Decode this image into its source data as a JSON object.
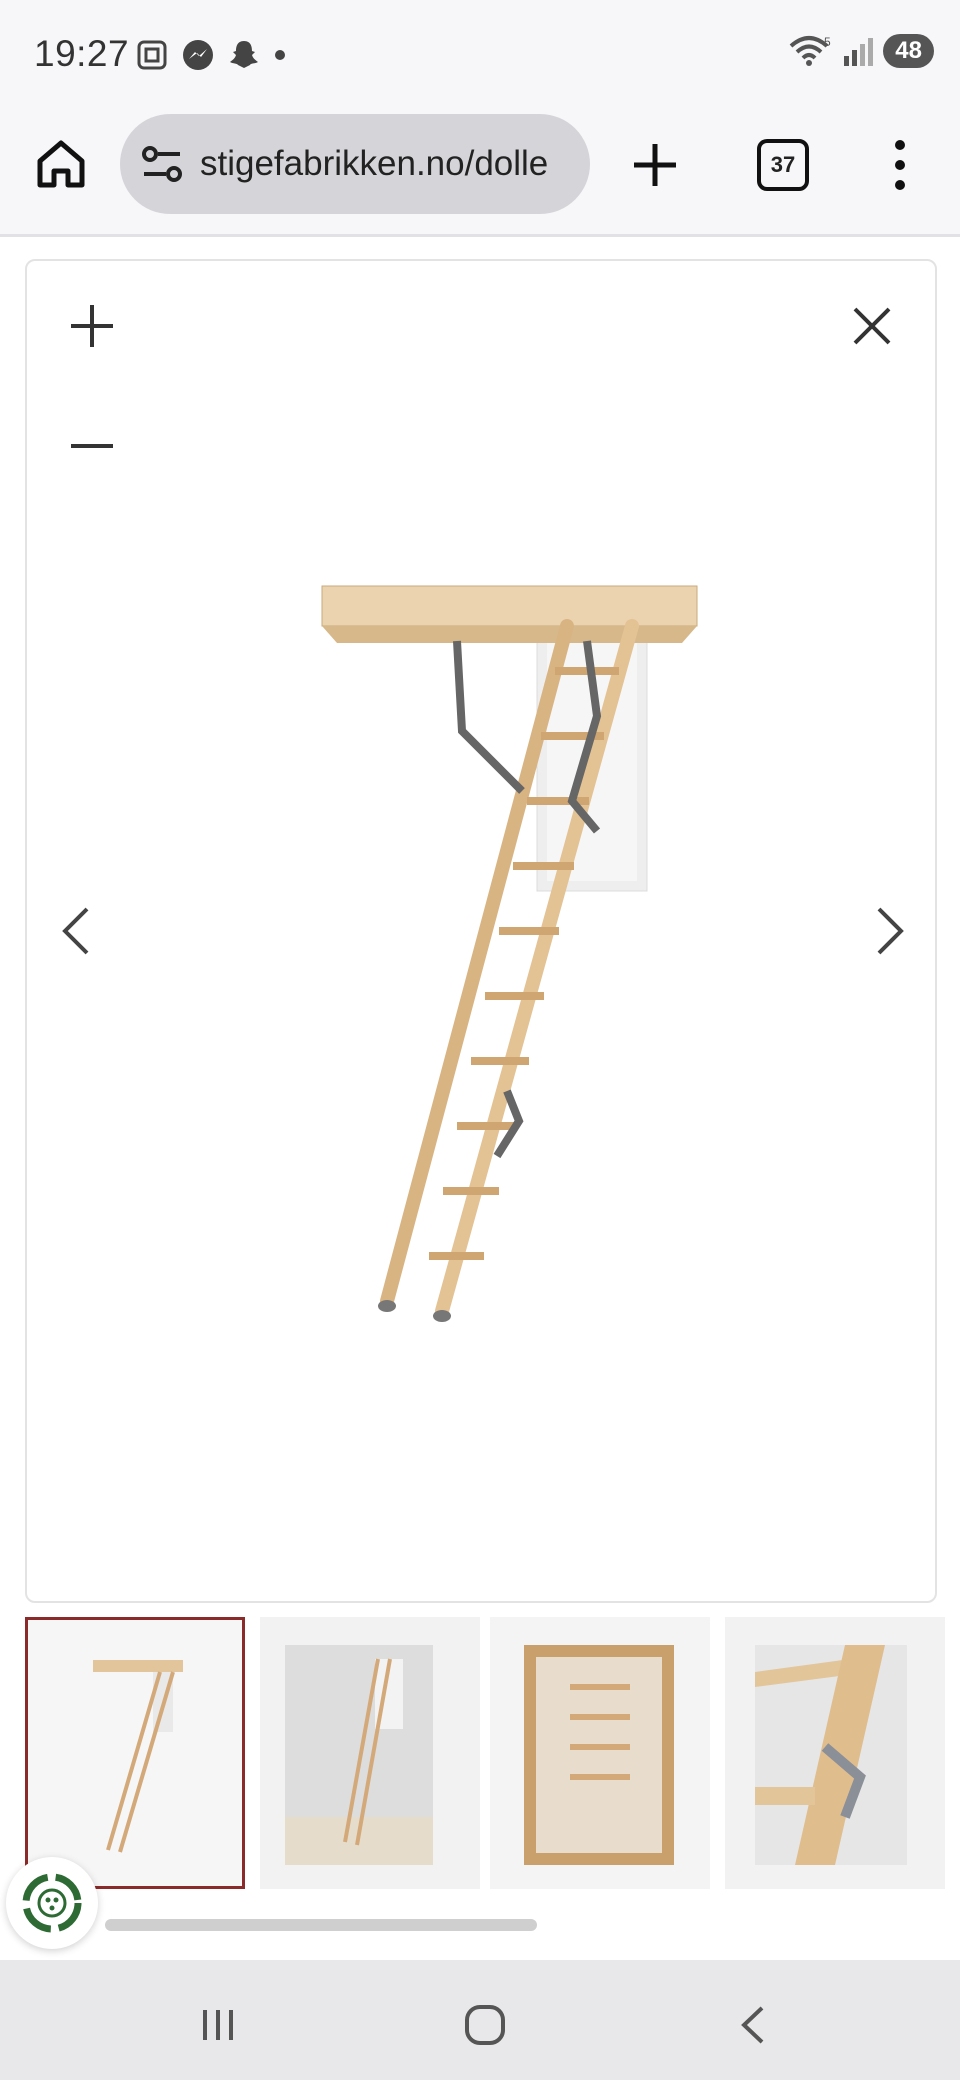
{
  "status_bar": {
    "time": "19:27",
    "left_icons": [
      "screenshot-icon",
      "messenger-icon",
      "snapchat-icon",
      "dot-icon"
    ],
    "right_icons": [
      "wifi-icon",
      "signal-icon"
    ],
    "wifi_badge": "5",
    "battery": "48"
  },
  "toolbar": {
    "url": "stigefabrikken.no/dolle",
    "tab_count": "37",
    "icons": [
      "home-icon",
      "site-settings-icon",
      "plus-icon",
      "tab-switcher-icon",
      "more-vert-icon"
    ]
  },
  "lightbox": {
    "controls": [
      "zoom-in-icon",
      "zoom-out-icon",
      "close-icon",
      "chevron-left-icon",
      "chevron-right-icon"
    ],
    "main_image": "attic-ladder-image"
  },
  "thumbnails": [
    {
      "name": "thumb-ladder-white-bg",
      "selected": true
    },
    {
      "name": "thumb-ladder-room",
      "selected": false
    },
    {
      "name": "thumb-ladder-top-view",
      "selected": false
    },
    {
      "name": "thumb-ladder-hinge-detail",
      "selected": false
    }
  ],
  "colors": {
    "selected_border": "#8b2a2a",
    "wood": "#e6c9a0",
    "hatch": "#f2f2f2"
  },
  "nav_bar": {
    "icons": [
      "recent-apps-icon",
      "home-circle-icon",
      "back-icon"
    ]
  }
}
